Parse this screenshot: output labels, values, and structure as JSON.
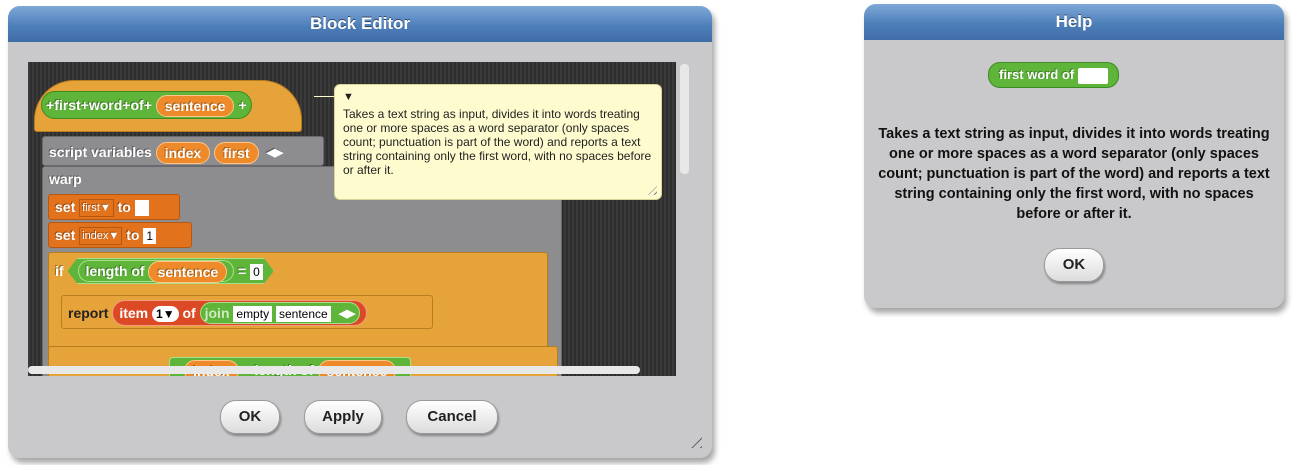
{
  "editor": {
    "title": "Block Editor",
    "hat": {
      "parts": [
        "+",
        "first",
        "+",
        "word",
        "+",
        "of",
        "+"
      ],
      "param": "sentence",
      "end": "+"
    },
    "script_vars": {
      "label": "script variables",
      "var1": "index",
      "var2": "first"
    },
    "warp": "warp",
    "set1": {
      "label": "set",
      "var": "first",
      "to": "to",
      "value": ""
    },
    "set2": {
      "label": "set",
      "var": "index",
      "to": "to",
      "value": "1"
    },
    "if_block": {
      "label": "if",
      "length": "length of",
      "arg": "sentence",
      "eq": "=",
      "value": "0"
    },
    "report": {
      "label": "report",
      "item": "item",
      "index": "1",
      "of": "of",
      "join": "join",
      "empty": "empty",
      "sentence": "sentence"
    },
    "bottom_partial": {
      "a": "index",
      "b": "length of",
      "c": "sentence"
    },
    "comment": "Takes a text string as input, divides it into words treating one or more spaces as a word separator (only spaces count; punctuation is part of the word) and reports a text string containing only the first word, with no spaces before or after it.",
    "buttons": {
      "ok": "OK",
      "apply": "Apply",
      "cancel": "Cancel"
    }
  },
  "help": {
    "title": "Help",
    "block_label": "first word of",
    "text": "Takes a text string as input, divides it into words treating one or more spaces as a word separator (only spaces count; punctuation is part of the word) and reports a text string containing only the first word, with no spaces before or after it.",
    "ok": "OK"
  },
  "colors": {
    "title_bar": "#4f7fba",
    "dialog_bg": "#c9c9cb",
    "control_orange": "#e3721d",
    "operator_green": "#5fb53a",
    "list_red": "#db4a25",
    "comment_bg": "#fefccf"
  }
}
